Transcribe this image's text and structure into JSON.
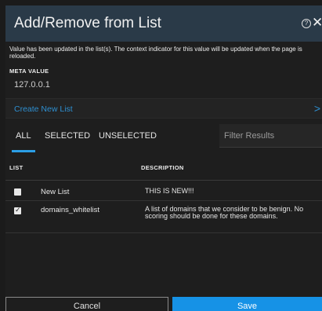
{
  "dialog": {
    "title": "Add/Remove from List",
    "help_icon": "help-circle-icon",
    "close_icon": "close-icon",
    "notice": "Value has been updated in the list(s). The context indicator for this value will be updated when the page is reloaded.",
    "meta_label": "META VALUE",
    "meta_value": "127.0.0.1",
    "create_label": "Create New List",
    "chevron_icon": "chevron-right-icon"
  },
  "tabs": [
    {
      "label": "ALL",
      "active": true
    },
    {
      "label": "SELECTED",
      "active": false
    },
    {
      "label": "UNSELECTED",
      "active": false
    }
  ],
  "filter": {
    "placeholder": "Filter Results",
    "value": ""
  },
  "table": {
    "columns": [
      "LIST",
      "DESCRIPTION"
    ],
    "rows": [
      {
        "checked": false,
        "name": "New List",
        "description_lines": [
          "THIS IS NEW!!!"
        ]
      },
      {
        "checked": true,
        "name": "domains_whitelist",
        "description_lines": [
          "A list of domains that we consider to be benign. No",
          "scoring should be done for these domains."
        ]
      }
    ]
  },
  "footer": {
    "cancel_label": "Cancel",
    "save_label": "Save"
  },
  "colors": {
    "header_bg": "#2a3a48",
    "accent": "#1692e6",
    "link": "#2e8fd0",
    "background": "#1e1e1e"
  }
}
